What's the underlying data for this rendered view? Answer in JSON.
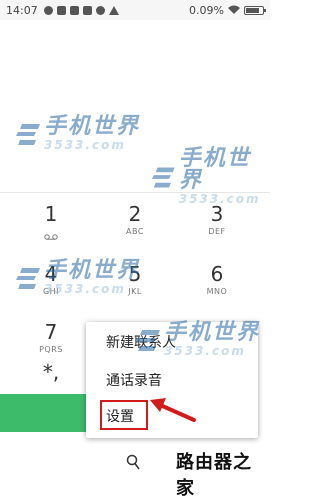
{
  "status_bar": {
    "time": "14:07",
    "battery_text": "0.09%"
  },
  "watermark": {
    "title": "手机世界",
    "sub": "3533.com"
  },
  "keypad": {
    "keys": [
      {
        "digit": "1",
        "letters": ""
      },
      {
        "digit": "2",
        "letters": "ABC"
      },
      {
        "digit": "3",
        "letters": "DEF"
      },
      {
        "digit": "4",
        "letters": "GHI"
      },
      {
        "digit": "5",
        "letters": "JKL"
      },
      {
        "digit": "6",
        "letters": "MNO"
      },
      {
        "digit": "7",
        "letters": "PQRS"
      },
      {
        "digit": "*,",
        "letters": ""
      }
    ],
    "call_color": "#3dbb6b"
  },
  "menu": {
    "items": [
      "新建联系人",
      "通话录音",
      "设置"
    ]
  },
  "bottom_watermark": "路由器之家",
  "colors": {
    "highlight": "#d31b1b",
    "watermark_blue": "#2a6aa6"
  }
}
